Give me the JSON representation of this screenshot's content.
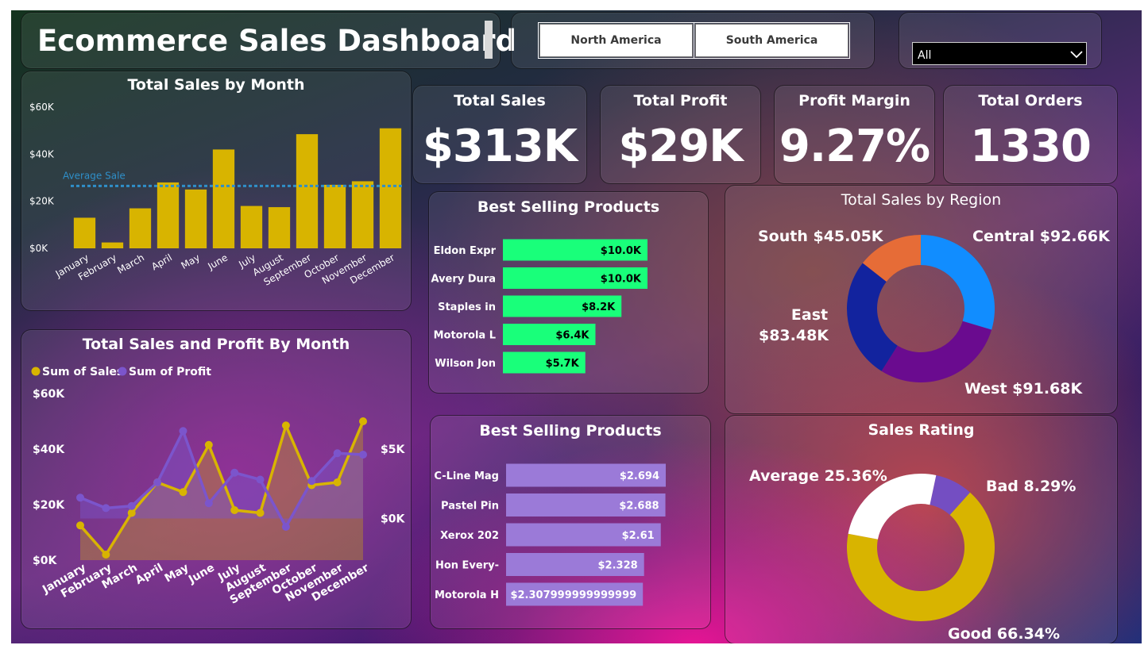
{
  "header": {
    "title": "Ecommerce Sales Dashboard"
  },
  "filters": {
    "regions": [
      "North America",
      "South America"
    ],
    "dropdown_value": "All"
  },
  "kpis": [
    {
      "title": "Total Sales",
      "value": "$313K"
    },
    {
      "title": "Total Profit",
      "value": "$29K"
    },
    {
      "title": "Profit Margin",
      "value": "9.27%"
    },
    {
      "title": "Total Orders",
      "value": "1330"
    }
  ],
  "colors": {
    "sales_gold": "#d8b400",
    "profit_purple": "#7b55cc",
    "avg_line": "#2f8fc8",
    "bar_green": "#19ff7a",
    "bar_lavender": "#9b7ad8",
    "central": "#118dff",
    "west": "#6a0b8f",
    "east": "#12239e",
    "south": "#e66c37",
    "good": "#d8b400",
    "average": "#ffffff",
    "bad": "#744ec2"
  },
  "chart_data": [
    {
      "id": "sales_by_month",
      "type": "bar",
      "title": "Total Sales by Month",
      "categories": [
        "January",
        "February",
        "March",
        "April",
        "May",
        "June",
        "July",
        "August",
        "September",
        "October",
        "November",
        "December"
      ],
      "values": [
        13000,
        2500,
        17000,
        28000,
        25000,
        42000,
        18000,
        17500,
        48500,
        27000,
        28500,
        51000
      ],
      "ylim": [
        0,
        60000
      ],
      "yticks": [
        "$0K",
        "$20K",
        "$40K",
        "$60K"
      ],
      "reference_line": {
        "label": "Average Sale",
        "value": 26500
      }
    },
    {
      "id": "sales_profit_by_month",
      "type": "line",
      "title": "Total Sales and Profit By Month",
      "categories": [
        "January",
        "February",
        "March",
        "April",
        "May",
        "June",
        "July",
        "August",
        "September",
        "October",
        "November",
        "December"
      ],
      "legend": [
        "Sum of Sales",
        "Sum of Profit"
      ],
      "series": [
        {
          "name": "Sum of Sales",
          "axis": "left",
          "values": [
            12500,
            2000,
            17000,
            28000,
            24500,
            41500,
            18000,
            17000,
            48500,
            27000,
            28000,
            50000
          ]
        },
        {
          "name": "Sum of Profit",
          "axis": "right",
          "values": [
            1500,
            750,
            900,
            2600,
            6300,
            1100,
            3300,
            2800,
            -600,
            2700,
            4700,
            4600
          ]
        }
      ],
      "left_ylim": [
        0,
        60000
      ],
      "left_yticks": [
        "$0K",
        "$20K",
        "$40K",
        "$60K"
      ],
      "right_ylim": [
        -3000,
        9000
      ],
      "right_yticks": [
        "$0K",
        "$5K"
      ]
    },
    {
      "id": "best_selling_products",
      "type": "bar",
      "orientation": "horizontal",
      "title": "Best Selling Products",
      "categories": [
        "Eldon Expr",
        "Avery Dura",
        "Staples in",
        "Motorola L",
        "Wilson Jon"
      ],
      "values": [
        10.0,
        10.0,
        8.2,
        6.4,
        5.7
      ],
      "labels": [
        "$10.0K",
        "$10.0K",
        "$8.2K",
        "$6.4K",
        "$5.7K"
      ]
    },
    {
      "id": "best_selling_products_2",
      "type": "bar",
      "orientation": "horizontal",
      "title": "Best Selling Products",
      "categories": [
        "C-Line Mag",
        "Pastel Pin",
        "Xerox 202",
        "Hon Every-",
        "Motorola H"
      ],
      "values": [
        2.694,
        2.688,
        2.61,
        2.328,
        2.308
      ],
      "labels": [
        "$2.694",
        "$2.688",
        "$2.61",
        "$2.328",
        "$2.307999999999999"
      ]
    },
    {
      "id": "sales_by_region",
      "type": "pie",
      "title": "Total Sales by Region",
      "slices": [
        {
          "name": "Central",
          "label": "Central $92.66K",
          "value": 92.66
        },
        {
          "name": "West",
          "label": "West $91.68K",
          "value": 91.68
        },
        {
          "name": "East",
          "label_lines": [
            "East",
            "$83.48K"
          ],
          "value": 83.48
        },
        {
          "name": "South",
          "label": "South $45.05K",
          "value": 45.05
        }
      ]
    },
    {
      "id": "sales_rating",
      "type": "pie",
      "title": "Sales Rating",
      "slices": [
        {
          "name": "Bad",
          "label": "Bad 8.29%",
          "value": 8.29
        },
        {
          "name": "Good",
          "label": "Good 66.34%",
          "value": 66.34
        },
        {
          "name": "Average",
          "label": "Average 25.36%",
          "value": 25.36
        }
      ]
    }
  ]
}
